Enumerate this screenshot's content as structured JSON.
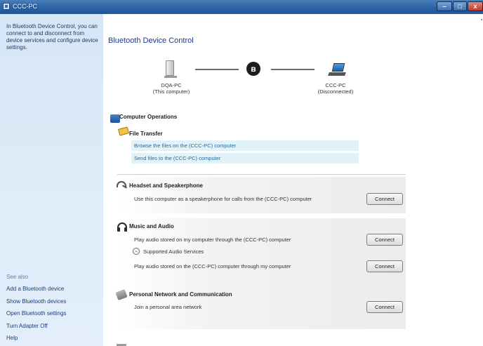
{
  "window": {
    "title": "CCC-PC",
    "min_glyph": "–",
    "max_glyph": "□",
    "close_glyph": "x"
  },
  "sidebar": {
    "description": "In Bluetooth Device Control, you can connect to and disconnect from device services and configure device settings.",
    "see_also": "See also",
    "links": [
      "Add a Bluetooth device",
      "Show Bluetooth devices",
      "Open Bluetooth settings",
      "Turn Adapter Off",
      "Help"
    ]
  },
  "main": {
    "title": "Bluetooth Device Control",
    "local_device": {
      "name": "DQA-PC",
      "status": "(This computer)"
    },
    "remote_device": {
      "name": "CCC-PC",
      "status": "(Disconnected)"
    },
    "bluetooth_glyph": "ʙ",
    "computer_operations": {
      "title": "Computer Operations",
      "file_transfer": {
        "title": "File Transfer",
        "links": [
          "Browse the files on the (CCC-PC) computer",
          "Send files to the (CCC-PC) computer"
        ]
      }
    },
    "headset": {
      "title": "Headset and Speakerphone",
      "description": "Use this computer as a speakerphone for calls from the (CCC-PC) computer",
      "button": "Connect"
    },
    "music": {
      "title": "Music and Audio",
      "row1": "Play audio stored on my computer through the (CCC-PC) computer",
      "row1_button": "Connect",
      "supported_label": "Supported Audio Services",
      "expand_glyph": "⌄",
      "row2": "Play audio stored on the (CCC-PC) computer through my computer",
      "row2_button": "Connect"
    },
    "network": {
      "title": "Personal Network and Communication",
      "description": "Join a personal area network",
      "button": "Connect"
    }
  }
}
